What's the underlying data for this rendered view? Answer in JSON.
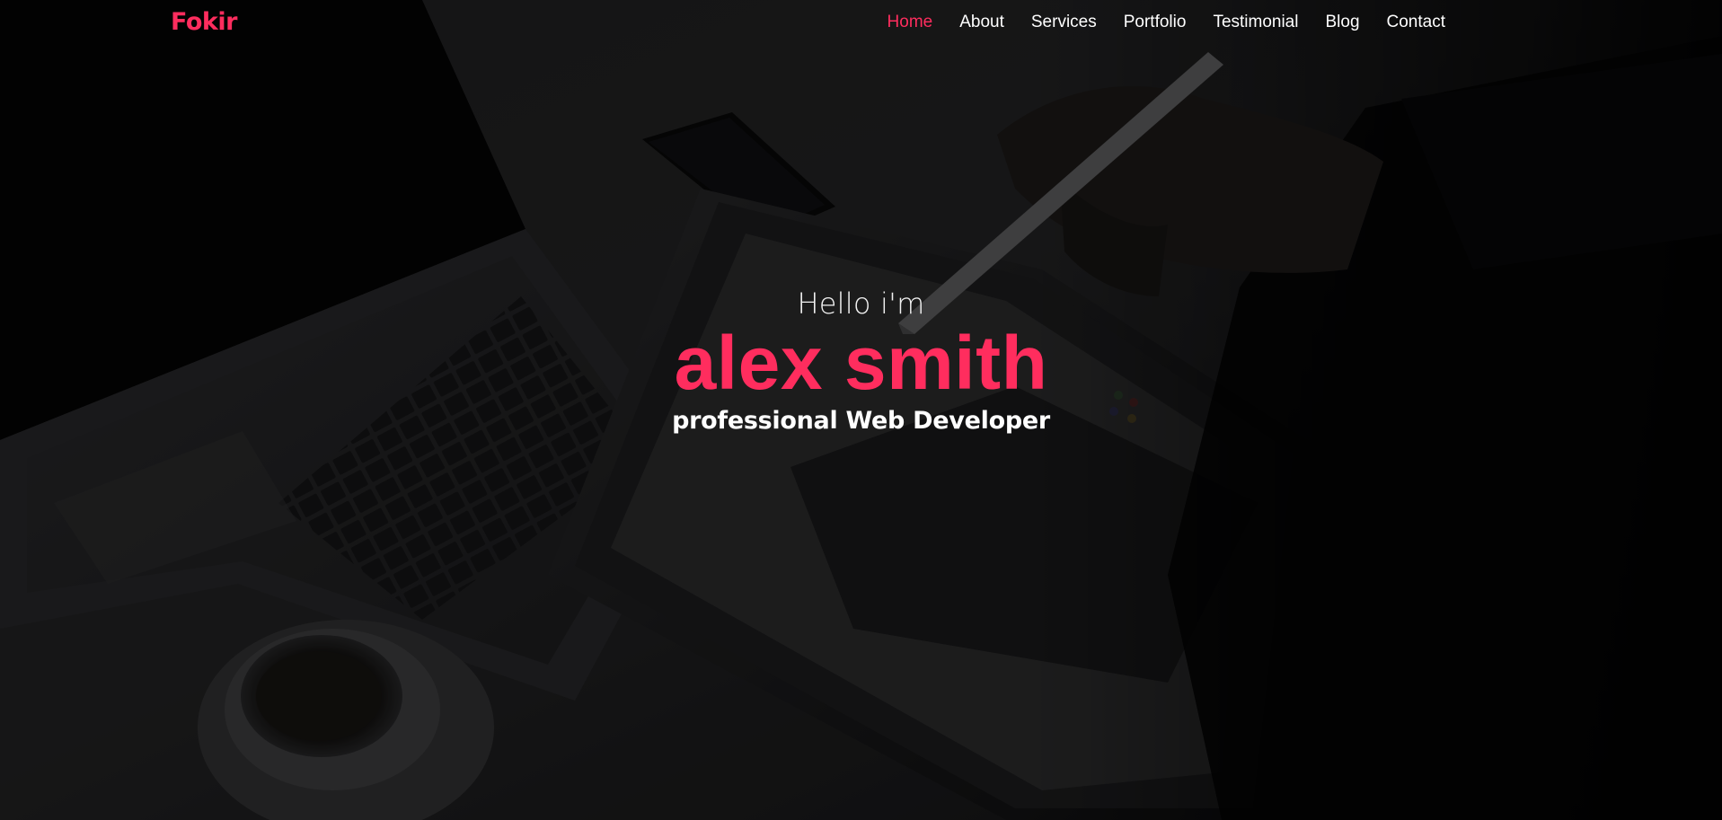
{
  "theme": {
    "accent": "#ff2d5e",
    "text": "#ffffff",
    "overlay": "#000000"
  },
  "brand": {
    "name": "Fokir"
  },
  "nav": {
    "items": [
      {
        "label": "Home",
        "active": true
      },
      {
        "label": "About",
        "active": false
      },
      {
        "label": "Services",
        "active": false
      },
      {
        "label": "Portfolio",
        "active": false
      },
      {
        "label": "Testimonial",
        "active": false
      },
      {
        "label": "Blog",
        "active": false
      },
      {
        "label": "Contact",
        "active": false
      }
    ]
  },
  "hero": {
    "greeting": "Hello i'm",
    "name": "alex smith",
    "role": "professional Web Developer",
    "background": "photo of laptop, tablet with stylus, smartphone and coffee cup on a desk, darkened"
  }
}
